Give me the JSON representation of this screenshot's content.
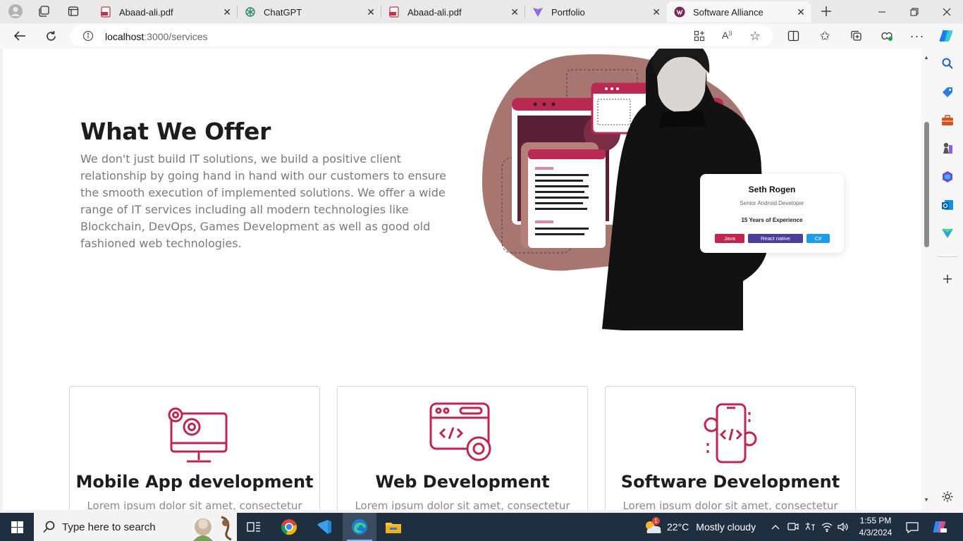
{
  "browser": {
    "tabs": [
      {
        "title": "Abaad-ali.pdf",
        "icon": "pdf-icon"
      },
      {
        "title": "ChatGPT",
        "icon": "chatgpt-icon"
      },
      {
        "title": "Abaad-ali.pdf",
        "icon": "pdf-icon"
      },
      {
        "title": "Portfolio",
        "icon": "vite-icon"
      },
      {
        "title": "Software Alliance",
        "icon": "site-logo-icon",
        "active": true
      }
    ],
    "url_host": "localhost",
    "url_path": ":3000/services"
  },
  "page": {
    "title": "What We Offer",
    "description": "We don't just build IT solutions, we build a positive client relationship by going hand in hand with our customers to ensure the smooth execution of implemented solutions. We offer a wide range of IT services including all modern technologies like Blockchain, DevOps, Games Development as well as good old fashioned web technologies.",
    "profile": {
      "name": "Seth Rogen",
      "role": "Senior Android Developer",
      "experience": "15 Years of Experience",
      "tags": [
        {
          "label": "Java",
          "color": "#c0254f"
        },
        {
          "label": "React native",
          "color": "#4b3f9a"
        },
        {
          "label": "C#",
          "color": "#1f9be8"
        }
      ]
    },
    "services": [
      {
        "title": "Mobile App development",
        "text": "Lorem ipsum dolor sit amet, consectetur"
      },
      {
        "title": "Web Development",
        "text": "Lorem ipsum dolor sit amet, consectetur"
      },
      {
        "title": "Software Development",
        "text": "Lorem ipsum dolor sit amet, consectetur"
      }
    ],
    "accent_color": "#c0254f",
    "blob_color": "#a87670"
  },
  "taskbar": {
    "search_placeholder": "Type here to search",
    "weather_temp": "22°C",
    "weather_desc": "Mostly cloudy",
    "weather_badge": "1",
    "time": "1:55 PM",
    "date": "4/3/2024"
  }
}
